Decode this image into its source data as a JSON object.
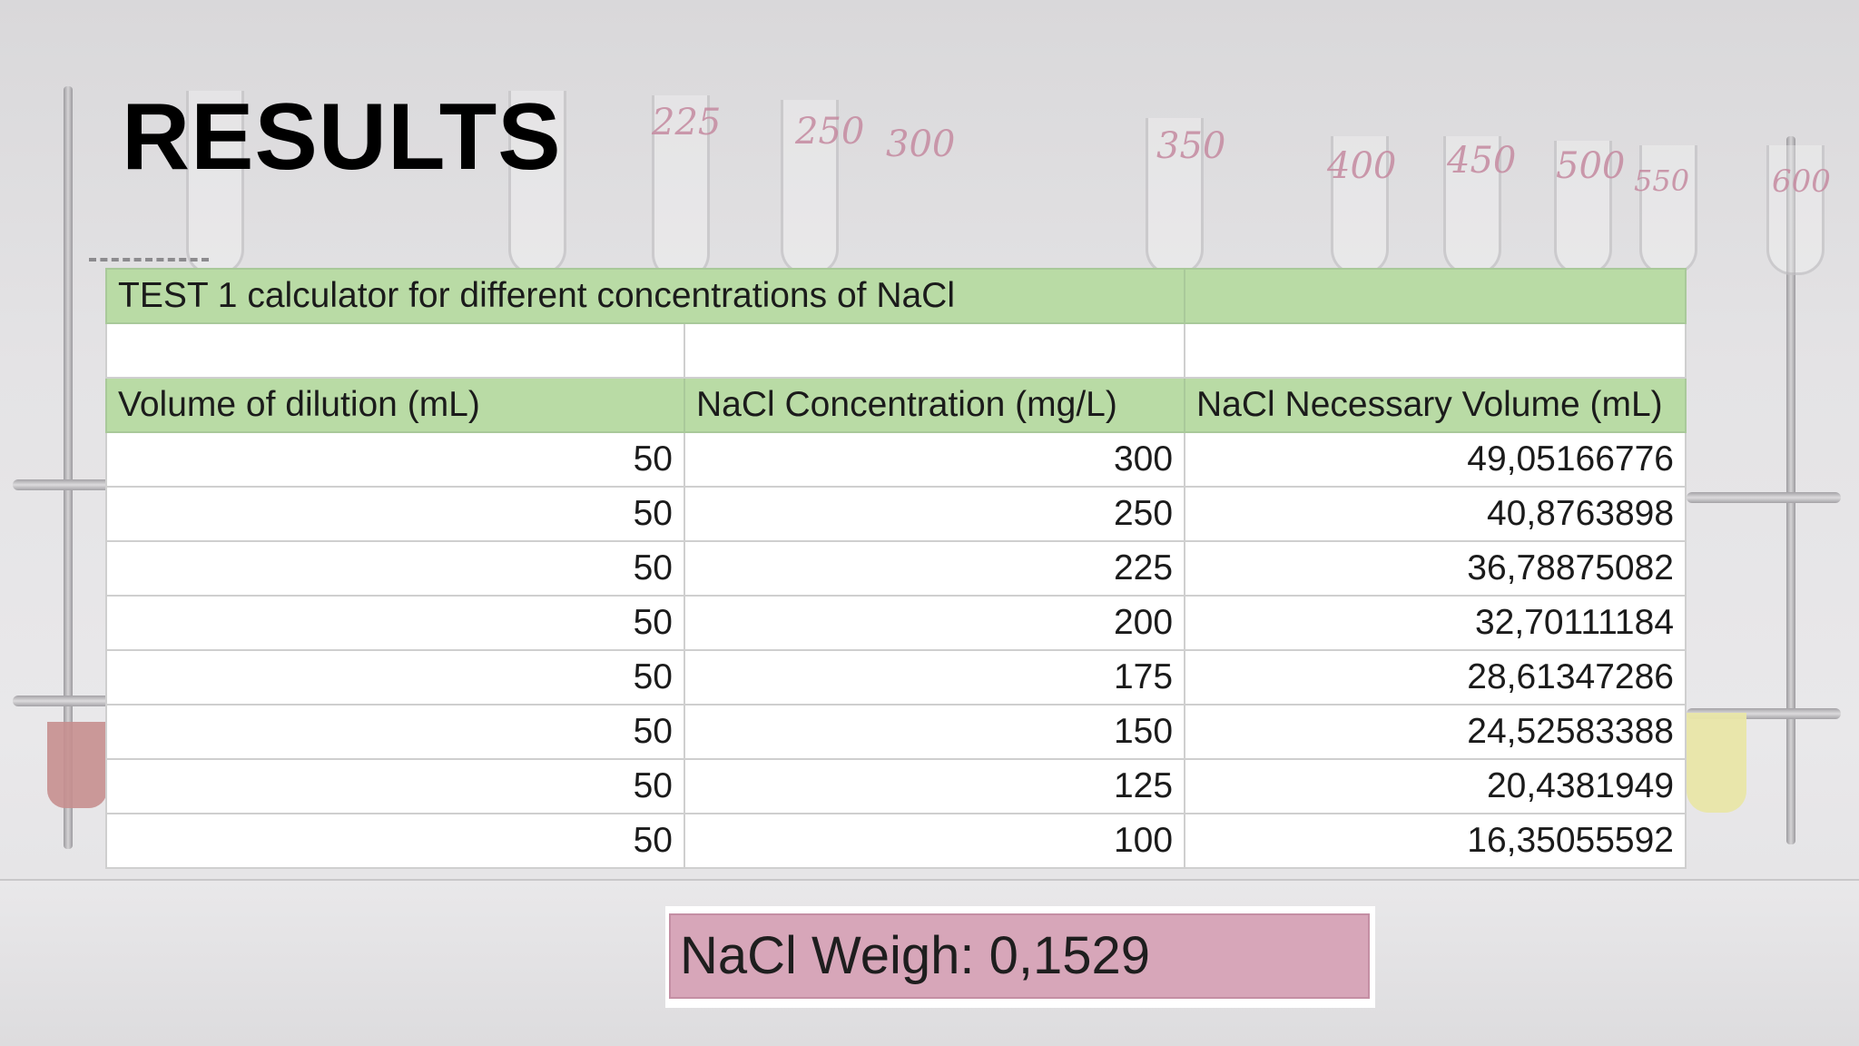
{
  "heading": "RESULTS",
  "background_labels": [
    "225",
    "250",
    "300",
    "350",
    "400",
    "450",
    "500",
    "550",
    "600"
  ],
  "table": {
    "title": "TEST 1 calculator for different concentrations of NaCl",
    "headers": [
      "Volume of dilution (mL)",
      "NaCl Concentration (mg/L)",
      "NaCl Necessary Volume (mL)"
    ],
    "rows": [
      [
        "50",
        "300",
        "49,05166776"
      ],
      [
        "50",
        "250",
        "40,8763898"
      ],
      [
        "50",
        "225",
        "36,78875082"
      ],
      [
        "50",
        "200",
        "32,70111184"
      ],
      [
        "50",
        "175",
        "28,61347286"
      ],
      [
        "50",
        "150",
        "24,52583388"
      ],
      [
        "50",
        "125",
        "20,4381949"
      ],
      [
        "50",
        "100",
        "16,35055592"
      ]
    ]
  },
  "weigh": "NaCl Weigh: 0,1529",
  "colors": {
    "header_green": "#b9dba5",
    "weigh_pink": "#d7a6b9"
  }
}
